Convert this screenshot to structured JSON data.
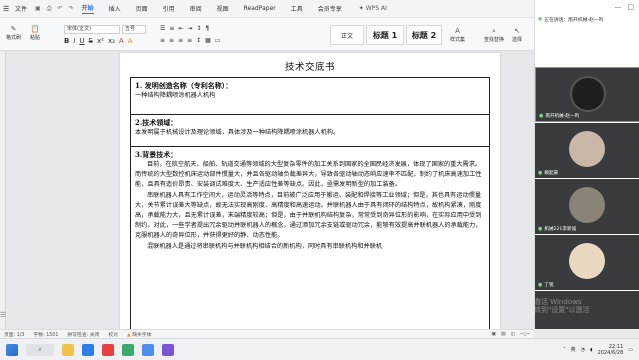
{
  "menubar": {
    "file": "文件",
    "tabs": [
      "开始",
      "插入",
      "页面",
      "引用",
      "审阅",
      "视图",
      "ReadPaper",
      "工具",
      "会员专享"
    ],
    "active_tab": "开始",
    "ai": "WPS AI"
  },
  "ribbon": {
    "format_painter": "格式刷",
    "paste": "粘贴",
    "font_name": "宋体(正文)",
    "font_size": "五号",
    "styles": [
      "正文",
      "标题 1",
      "标题 2"
    ],
    "style_set": "样式集",
    "find_replace": "查找替换",
    "select": "选择",
    "text_tools": "文字工具",
    "sort": "排列"
  },
  "document": {
    "title": "技术交底书",
    "sections": [
      {
        "heading": "1. 发明创造名称（专利名称）：",
        "body": "一种结构降耦喷涂机器人机构"
      },
      {
        "heading": "2.技术领域：",
        "body": "本发明属于机械设计及理论领域，具体涉及一种结构降耦喷涂机器人机构。"
      },
      {
        "heading": "3.背景技术：",
        "paragraphs": [
          "目前，在航空航天、船舶、轨道交通等领域的大型复杂零件的加工关系到国家的全国民经济发展，体现了国家的重大需求。而传统的大型数控机床运动部件惯量大，并且各驱动轴负载差异大，导致各驱动轴动态响应速率不匹配，制约了机床高速加工性能，且具有造价昂贵、安装调试难度大、生产适应性差等缺点。因此，亟需发明新型的加工装备。",
          "串联机器人具有工作空间大，运动灵活等特点，目前被广泛应用于搬运、装配和焊接等工业领域；但是，其也具有运动惯量大，关节累计误差大等缺点，故无法实现高刚度、高精度和高速运动。并联机器人由于具有闭环的结构特点，故机构紧凑，刚度高，承载能力大，且无累计误差，末端精度较高；但是，由于并联机构结构复杂，常常受到奇异位形的影响，在实际应用中受到制约。对此，一些学者提出冗余驱动并联机器人的概念，通过添加冗余支链或驱动冗余，能够有效提高并联机器人的承载能力，克服机器人的奇异位形，并获得更好的静、动态性能。",
          "混联机器人是通过将串联机构与并联机构相结合的新机构，同时具有串联机构和并联机"
        ]
      }
    ]
  },
  "status": {
    "page": "页面: 1/3",
    "words": "字数: 1501",
    "spell": "拼写检查: 关闭",
    "proof": "校对",
    "font_missing": "缺失字体"
  },
  "meeting": {
    "header": "正在讲话：南开机械-赵一鸣",
    "participants": [
      {
        "name": "南开机械-赵一鸣",
        "color": "#2f2f33"
      },
      {
        "name": "赖起豪",
        "color": "#5a4a45"
      },
      {
        "name": "机械221李新诚",
        "color": "#4b4a44"
      },
      {
        "name": "丁铭",
        "color": "#6a5a4a"
      }
    ]
  },
  "watermark": [
    "激活 Windows",
    "转到\"设置\"以激活"
  ],
  "taskbar": {
    "ime": "英",
    "time": "22:11",
    "date": "2024/6/28"
  },
  "colors": {
    "accent": "#2f6fe4"
  }
}
